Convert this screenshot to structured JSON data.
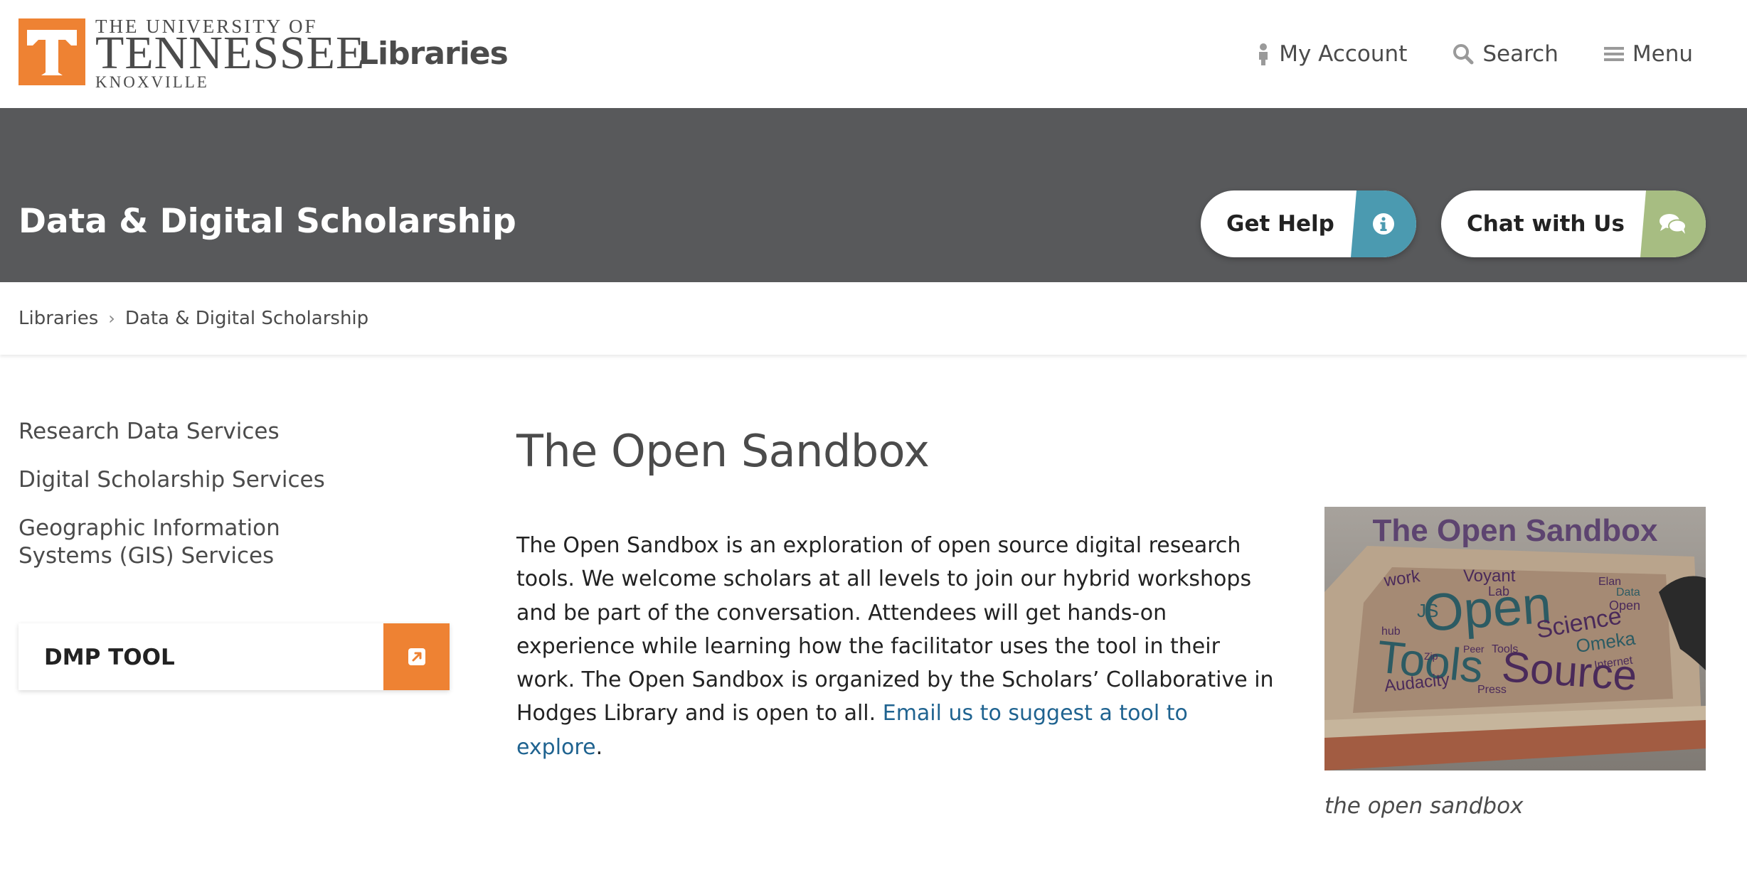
{
  "header": {
    "logo": {
      "line1": "THE UNIVERSITY OF",
      "line2": "TENNESSEE",
      "line3": "KNOXVILLE"
    },
    "site_name": "Libraries",
    "utility_nav": [
      {
        "label": "My Account",
        "icon": "person-icon"
      },
      {
        "label": "Search",
        "icon": "search-icon"
      },
      {
        "label": "Menu",
        "icon": "hamburger-icon"
      }
    ]
  },
  "banner": {
    "title": "Data & Digital Scholarship",
    "get_help": {
      "label": "Get Help",
      "icon": "info-icon",
      "color": "#4b9ab0"
    },
    "chat": {
      "label": "Chat with Us",
      "icon": "chat-bubbles-icon",
      "color": "#a7bd82"
    },
    "background": "#58595b"
  },
  "breadcrumb": {
    "items": [
      "Libraries",
      "Data & Digital Scholarship"
    ],
    "separator": "›"
  },
  "sidebar": {
    "links": [
      "Research Data Services",
      "Digital Scholarship Services",
      "Geographic Information Systems (GIS) Services"
    ],
    "dmp_tool": {
      "label": "DMP TOOL",
      "icon": "external-link-icon",
      "color": "#ee8233"
    }
  },
  "main": {
    "title": "The Open Sandbox",
    "body": "The Open Sandbox is an exploration of open source digital research tools. We welcome scholars at all levels to join our hybrid workshops and be part of the conversation. Attendees will get hands-on experience while learning how the facilitator uses the tool in their work. The Open Sandbox is organized by the Scholars’ Collaborative in Hodges Library and is open to all.",
    "link_text": "Email us to suggest a tool to explore",
    "link_suffix": ".",
    "figure": {
      "image_title": "The Open Sandbox",
      "words": [
        "Open",
        "Tools",
        "Source",
        "Science",
        "Voyant",
        "Omeka",
        "JS",
        "Lab",
        "Audacity",
        "work",
        "Open",
        "Data",
        "Internet",
        "Zip",
        "Peer",
        "Tools",
        "hub",
        "Press",
        "Elan"
      ],
      "caption": "the open sandbox"
    }
  },
  "colors": {
    "brand_orange": "#ee8233",
    "link": "#1f6390",
    "text_gray": "#4b4b4b"
  }
}
